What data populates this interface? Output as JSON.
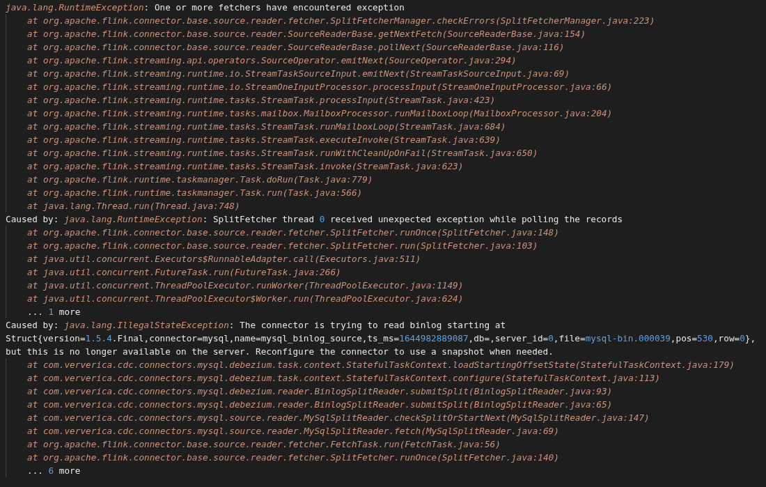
{
  "lines": [
    {
      "kind": "top",
      "parts": [
        {
          "kind": "italic",
          "text": "java.lang.RuntimeException"
        },
        {
          "kind": "plain",
          "text": ": One or more fetchers have encountered exception"
        }
      ]
    },
    {
      "kind": "nested",
      "parts": [
        {
          "kind": "italic",
          "text": "at org.apache.flink.connector.base.source.reader.fetcher.SplitFetcherManager.checkErrors(SplitFetcherManager.java:223)"
        }
      ]
    },
    {
      "kind": "nested",
      "parts": [
        {
          "kind": "italic",
          "text": "at org.apache.flink.connector.base.source.reader.SourceReaderBase.getNextFetch(SourceReaderBase.java:154)"
        }
      ]
    },
    {
      "kind": "nested",
      "parts": [
        {
          "kind": "italic",
          "text": "at org.apache.flink.connector.base.source.reader.SourceReaderBase.pollNext(SourceReaderBase.java:116)"
        }
      ]
    },
    {
      "kind": "nested",
      "parts": [
        {
          "kind": "italic",
          "text": "at org.apache.flink.streaming.api.operators.SourceOperator.emitNext(SourceOperator.java:294)"
        }
      ]
    },
    {
      "kind": "nested",
      "parts": [
        {
          "kind": "italic",
          "text": "at org.apache.flink.streaming.runtime.io.StreamTaskSourceInput.emitNext(StreamTaskSourceInput.java:69)"
        }
      ]
    },
    {
      "kind": "nested",
      "parts": [
        {
          "kind": "italic",
          "text": "at org.apache.flink.streaming.runtime.io.StreamOneInputProcessor.processInput(StreamOneInputProcessor.java:66)"
        }
      ]
    },
    {
      "kind": "nested",
      "parts": [
        {
          "kind": "italic",
          "text": "at org.apache.flink.streaming.runtime.tasks.StreamTask.processInput(StreamTask.java:423)"
        }
      ]
    },
    {
      "kind": "nested",
      "parts": [
        {
          "kind": "italic",
          "text": "at org.apache.flink.streaming.runtime.tasks.mailbox.MailboxProcessor.runMailboxLoop(MailboxProcessor.java:204)"
        }
      ]
    },
    {
      "kind": "nested",
      "parts": [
        {
          "kind": "italic",
          "text": "at org.apache.flink.streaming.runtime.tasks.StreamTask.runMailboxLoop(StreamTask.java:684)"
        }
      ]
    },
    {
      "kind": "nested",
      "parts": [
        {
          "kind": "italic",
          "text": "at org.apache.flink.streaming.runtime.tasks.StreamTask.executeInvoke(StreamTask.java:639)"
        }
      ]
    },
    {
      "kind": "nested",
      "parts": [
        {
          "kind": "italic",
          "text": "at org.apache.flink.streaming.runtime.tasks.StreamTask.runWithCleanUpOnFail(StreamTask.java:650)"
        }
      ]
    },
    {
      "kind": "nested",
      "parts": [
        {
          "kind": "italic",
          "text": "at org.apache.flink.streaming.runtime.tasks.StreamTask.invoke(StreamTask.java:623)"
        }
      ]
    },
    {
      "kind": "nested",
      "parts": [
        {
          "kind": "italic",
          "text": "at org.apache.flink.runtime.taskmanager.Task.doRun(Task.java:779)"
        }
      ]
    },
    {
      "kind": "nested",
      "parts": [
        {
          "kind": "italic",
          "text": "at org.apache.flink.runtime.taskmanager.Task.run(Task.java:566)"
        }
      ]
    },
    {
      "kind": "nested",
      "parts": [
        {
          "kind": "italic",
          "text": "at java.lang.Thread.run(Thread.java:748)"
        }
      ]
    },
    {
      "kind": "top",
      "parts": [
        {
          "kind": "plain",
          "text": "Caused by: "
        },
        {
          "kind": "italic",
          "text": "java.lang.RuntimeException"
        },
        {
          "kind": "plain",
          "text": ": SplitFetcher thread "
        },
        {
          "kind": "number",
          "text": "0"
        },
        {
          "kind": "plain",
          "text": " received unexpected exception while polling the records"
        }
      ]
    },
    {
      "kind": "nested",
      "parts": [
        {
          "kind": "italic",
          "text": "at org.apache.flink.connector.base.source.reader.fetcher.SplitFetcher.runOnce(SplitFetcher.java:148)"
        }
      ]
    },
    {
      "kind": "nested",
      "parts": [
        {
          "kind": "italic",
          "text": "at org.apache.flink.connector.base.source.reader.fetcher.SplitFetcher.run(SplitFetcher.java:103)"
        }
      ]
    },
    {
      "kind": "nested",
      "parts": [
        {
          "kind": "italic",
          "text": "at java.util.concurrent.Executors$RunnableAdapter.call(Executors.java:511)"
        }
      ]
    },
    {
      "kind": "nested",
      "parts": [
        {
          "kind": "italic",
          "text": "at java.util.concurrent.FutureTask.run(FutureTask.java:266)"
        }
      ]
    },
    {
      "kind": "nested",
      "parts": [
        {
          "kind": "italic",
          "text": "at java.util.concurrent.ThreadPoolExecutor.runWorker(ThreadPoolExecutor.java:1149)"
        }
      ]
    },
    {
      "kind": "nested",
      "parts": [
        {
          "kind": "italic",
          "text": "at java.util.concurrent.ThreadPoolExecutor$Worker.run(ThreadPoolExecutor.java:624)"
        }
      ]
    },
    {
      "kind": "nested",
      "parts": [
        {
          "kind": "plain",
          "text": "... "
        },
        {
          "kind": "number",
          "text": "1"
        },
        {
          "kind": "plain",
          "text": " more"
        }
      ]
    },
    {
      "kind": "top",
      "parts": [
        {
          "kind": "plain",
          "text": "Caused by: "
        },
        {
          "kind": "italic",
          "text": "java.lang.IllegalStateException"
        },
        {
          "kind": "plain",
          "text": ": The connector is trying to read binlog starting at"
        }
      ]
    },
    {
      "kind": "top",
      "parts": [
        {
          "kind": "plain",
          "text": "Struct{version="
        },
        {
          "kind": "number",
          "text": "1.5.4"
        },
        {
          "kind": "plain",
          "text": ".Final,connector=mysql,name=mysql_binlog_source,ts_ms="
        },
        {
          "kind": "number",
          "text": "1644982889087"
        },
        {
          "kind": "plain",
          "text": ",db=,server_id="
        },
        {
          "kind": "number",
          "text": "0"
        },
        {
          "kind": "plain",
          "text": ",file="
        },
        {
          "kind": "number",
          "text": "mysql-bin.000039"
        },
        {
          "kind": "plain",
          "text": ",pos="
        },
        {
          "kind": "number",
          "text": "530"
        },
        {
          "kind": "plain",
          "text": ",row="
        },
        {
          "kind": "number",
          "text": "0"
        },
        {
          "kind": "plain",
          "text": "},"
        }
      ]
    },
    {
      "kind": "top",
      "parts": [
        {
          "kind": "plain",
          "text": "but this is no longer available on the server. Reconfigure the connector to use a snapshot when needed."
        }
      ]
    },
    {
      "kind": "nested",
      "parts": [
        {
          "kind": "italic",
          "text": "at com.ververica.cdc.connectors.mysql.debezium.task.context.StatefulTaskContext.loadStartingOffsetState(StatefulTaskContext.java:179)"
        }
      ]
    },
    {
      "kind": "nested",
      "parts": [
        {
          "kind": "italic",
          "text": "at com.ververica.cdc.connectors.mysql.debezium.task.context.StatefulTaskContext.configure(StatefulTaskContext.java:113)"
        }
      ]
    },
    {
      "kind": "nested",
      "parts": [
        {
          "kind": "italic",
          "text": "at com.ververica.cdc.connectors.mysql.debezium.reader.BinlogSplitReader.submitSplit(BinlogSplitReader.java:93)"
        }
      ]
    },
    {
      "kind": "nested",
      "parts": [
        {
          "kind": "italic",
          "text": "at com.ververica.cdc.connectors.mysql.debezium.reader.BinlogSplitReader.submitSplit(BinlogSplitReader.java:65)"
        }
      ]
    },
    {
      "kind": "nested",
      "parts": [
        {
          "kind": "italic",
          "text": "at com.ververica.cdc.connectors.mysql.source.reader.MySqlSplitReader.checkSplitOrStartNext(MySqlSplitReader.java:147)"
        }
      ]
    },
    {
      "kind": "nested",
      "parts": [
        {
          "kind": "italic",
          "text": "at com.ververica.cdc.connectors.mysql.source.reader.MySqlSplitReader.fetch(MySqlSplitReader.java:69)"
        }
      ]
    },
    {
      "kind": "nested",
      "parts": [
        {
          "kind": "italic",
          "text": "at org.apache.flink.connector.base.source.reader.fetcher.FetchTask.run(FetchTask.java:56)"
        }
      ]
    },
    {
      "kind": "nested",
      "parts": [
        {
          "kind": "italic",
          "text": "at org.apache.flink.connector.base.source.reader.fetcher.SplitFetcher.runOnce(SplitFetcher.java:140)"
        }
      ]
    },
    {
      "kind": "nested",
      "parts": [
        {
          "kind": "plain",
          "text": "... "
        },
        {
          "kind": "number",
          "text": "6"
        },
        {
          "kind": "plain",
          "text": " more"
        }
      ]
    }
  ]
}
